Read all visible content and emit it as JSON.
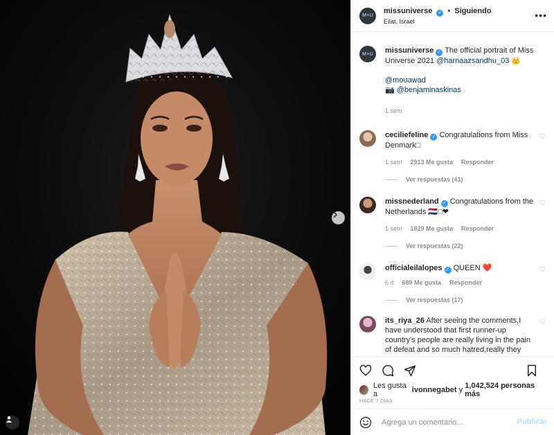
{
  "post": {
    "author": "missuniverse",
    "avatar_text": "M+U",
    "follow_separator": "•",
    "follow_label": "Siguiendo",
    "location": "Eilat, Israel",
    "more_label": "•••"
  },
  "caption": {
    "username": "missuniverse",
    "text": "The official portrait of Miss Universe 2021",
    "mention": "@harnaazsandhu_03",
    "emoji": "👑",
    "credit1": "@mouawad",
    "credit2_icon": "📷",
    "credit2": "@benjaminaskinas",
    "age": "1 sem"
  },
  "comments": [
    {
      "username": "ceciliefeline",
      "text": "Congratulations from Miss Denmark□",
      "age": "1 sem",
      "likes": "2913 Me gusta",
      "reply": "Responder",
      "replies": "Ver respuestas (41)",
      "avatar_color": "#c9a58a"
    },
    {
      "username": "missnederland",
      "text": "Congratulations from the Netherlands 🇳🇱□❤",
      "age": "1 sem",
      "likes": "1929 Me gusta",
      "reply": "Responder",
      "replies": "Ver respuestas (22)",
      "avatar_color": "#6a4a3c"
    },
    {
      "username": "officialeilalopes",
      "text": "QUEEN ❤️",
      "age": "6 d",
      "likes": "689 Me gusta",
      "reply": "Responder",
      "replies": "Ver respuestas (17)",
      "avatar_color": "#d8d8d8"
    },
    {
      "username": "its_riya_26",
      "text": "After seeing the comments,I have understood that first runner-up country's people are really living in the pain of defeat and so much hatred,really they don't have brains, who are showing so much anger and",
      "avatar_color": "#c49ab0"
    }
  ],
  "likes": {
    "prefix": "Les gusta a",
    "user": "ivonnegabet",
    "conj": "y",
    "count": "1,042,524 personas más"
  },
  "posted_ago": "HACE 7 DÍAS",
  "add_comment": {
    "placeholder": "Agrega un comentario...",
    "publish": "Publicar"
  },
  "icons": {
    "like": "heart-outline-icon",
    "comment": "comment-bubble-icon",
    "share": "paper-plane-icon",
    "save": "bookmark-icon",
    "emoji": "smiley-icon",
    "next": "chevron-right-icon",
    "tag": "person-tag-icon"
  },
  "colors": {
    "verified": "#3897f0",
    "link": "#00376b",
    "publish_disabled": "#b2dffc",
    "muted": "#8e8e8e"
  }
}
